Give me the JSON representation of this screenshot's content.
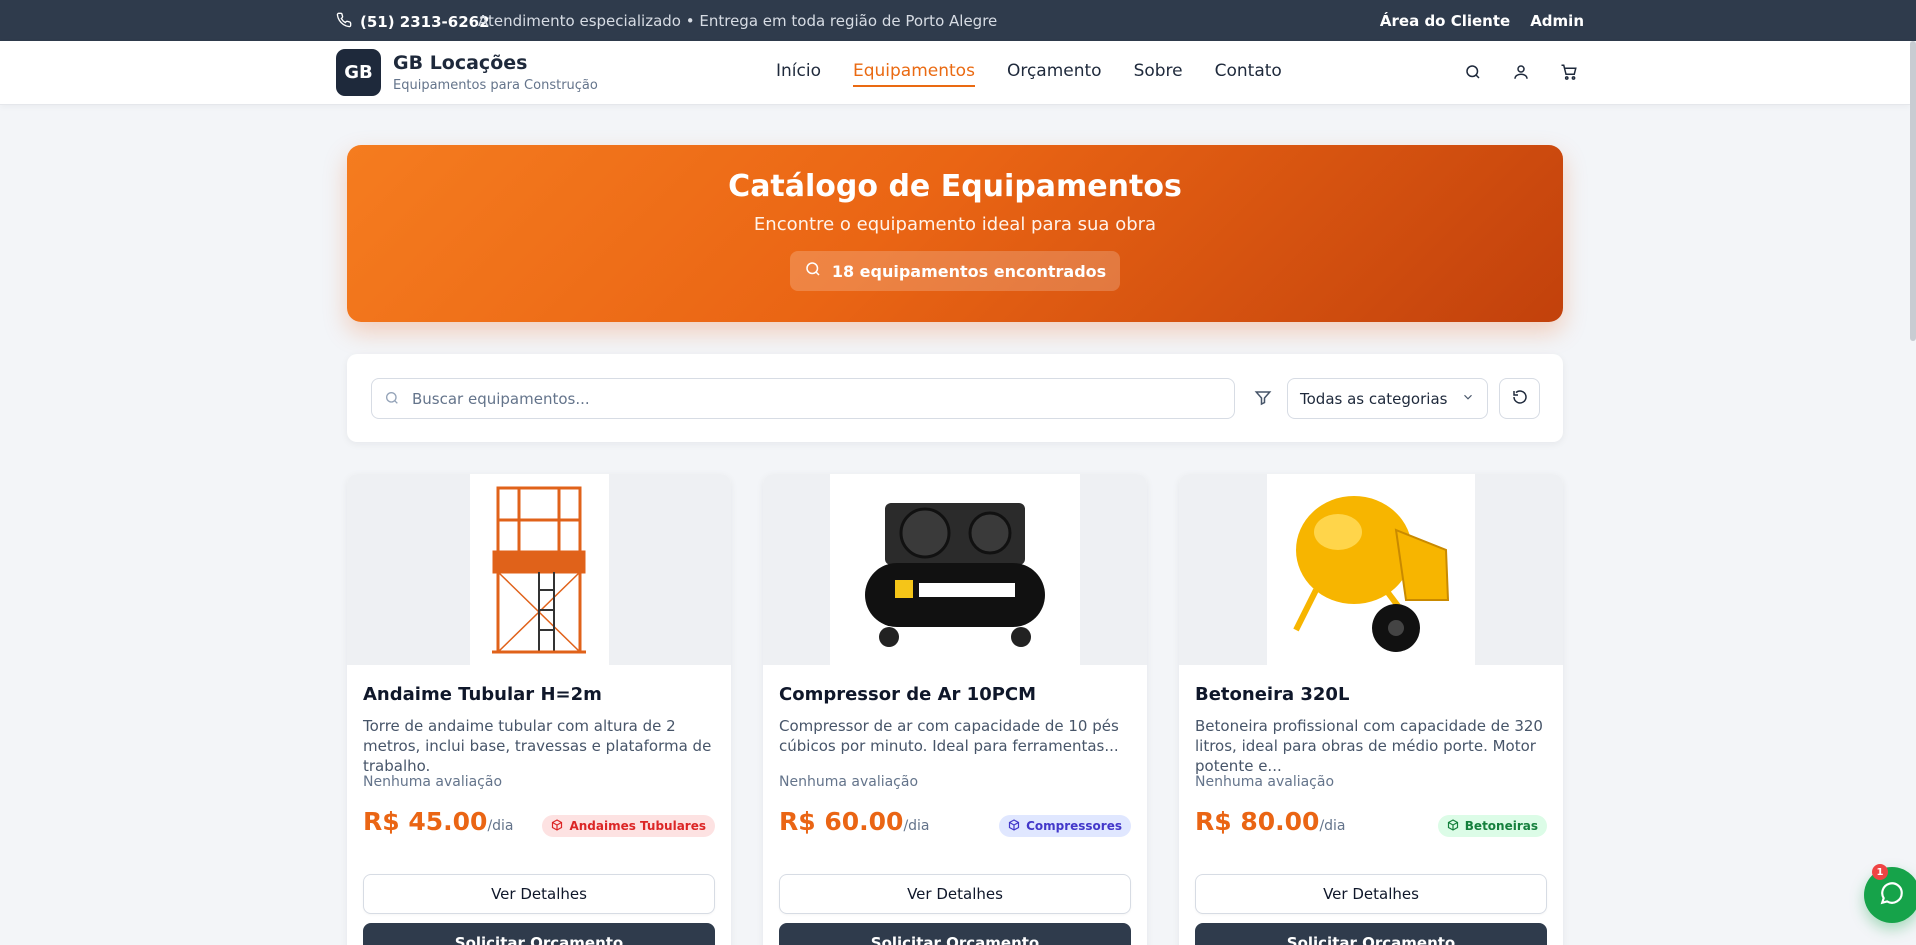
{
  "topbar": {
    "phone": "(51) 2313-6262",
    "tagline": "Atendimento especializado • Entrega em toda região de Porto Alegre",
    "client_area": "Área do Cliente",
    "admin": "Admin"
  },
  "header": {
    "logo_text": "GB",
    "brand_name": "GB Locações",
    "brand_sub": "Equipamentos para Construção",
    "nav": [
      "Início",
      "Equipamentos",
      "Orçamento",
      "Sobre",
      "Contato"
    ],
    "active_nav": "Equipamentos",
    "icons": [
      "search-icon",
      "user-icon",
      "cart-icon"
    ]
  },
  "hero": {
    "title": "Catálogo de Equipamentos",
    "subtitle": "Encontre o equipamento ideal para sua obra",
    "count_text": "18 equipamentos encontrados"
  },
  "filters": {
    "search_placeholder": "Buscar equipamentos...",
    "category_selected": "Todas as categorias"
  },
  "products": [
    {
      "name": "Andaime Tubular H=2m",
      "description": "Torre de andaime tubular com altura de 2 metros, inclui base, travessas e plataforma de trabalho.",
      "rating": "Nenhuma avaliação",
      "price": "R$ 45.00",
      "unit": "/dia",
      "category": "Andaimes Tubulares",
      "badge_color": "#dc2626",
      "badge_bg": "#fde2e2",
      "details_label": "Ver Detalhes",
      "quote_label": "Solicitar Orçamento"
    },
    {
      "name": "Compressor de Ar 10PCM",
      "description": "Compressor de ar com capacidade de 10 pés cúbicos por minuto. Ideal para ferramentas...",
      "rating": "Nenhuma avaliação",
      "price": "R$ 60.00",
      "unit": "/dia",
      "category": "Compressores",
      "badge_color": "#4338ca",
      "badge_bg": "#e0e7ff",
      "details_label": "Ver Detalhes",
      "quote_label": "Solicitar Orçamento"
    },
    {
      "name": "Betoneira 320L",
      "description": "Betoneira profissional com capacidade de 320 litros, ideal para obras de médio porte. Motor potente e...",
      "rating": "Nenhuma avaliação",
      "price": "R$ 80.00",
      "unit": "/dia",
      "category": "Betoneiras",
      "badge_color": "#15803d",
      "badge_bg": "#dcfce7",
      "details_label": "Ver Detalhes",
      "quote_label": "Solicitar Orçamento"
    }
  ],
  "chat": {
    "badge_count": "1"
  },
  "colors": {
    "accent": "#ea6514",
    "dark": "#2f3b4c",
    "whatsapp": "#16a34a"
  }
}
